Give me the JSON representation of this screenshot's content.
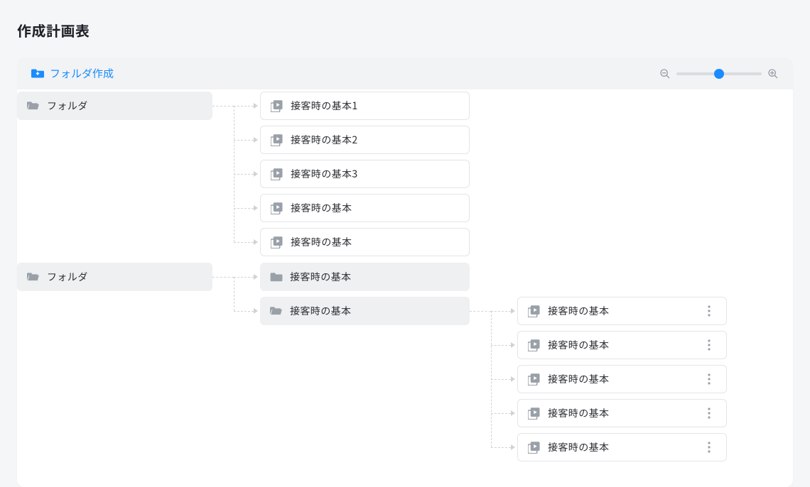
{
  "pageTitle": "作成計画表",
  "toolbar": {
    "createFolderLabel": "フォルダ作成",
    "zoomValue": 50
  },
  "root": [
    {
      "type": "folder",
      "label": "フォルダ",
      "children": [
        {
          "type": "item",
          "label": "接客時の基本1"
        },
        {
          "type": "item",
          "label": "接客時の基本2"
        },
        {
          "type": "item",
          "label": "接客時の基本3"
        },
        {
          "type": "item",
          "label": "接客時の基本"
        },
        {
          "type": "item",
          "label": "接客時の基本"
        }
      ]
    },
    {
      "type": "folder",
      "label": "フォルダ",
      "children": [
        {
          "type": "subfolder-closed",
          "label": "接客時の基本"
        },
        {
          "type": "subfolder-open",
          "label": "接客時の基本",
          "children": [
            {
              "type": "item",
              "label": "接客時の基本",
              "hasMenu": true
            },
            {
              "type": "item",
              "label": "接客時の基本",
              "hasMenu": true
            },
            {
              "type": "item",
              "label": "接客時の基本",
              "hasMenu": true
            },
            {
              "type": "item",
              "label": "接客時の基本",
              "hasMenu": true
            },
            {
              "type": "item",
              "label": "接客時の基本",
              "hasMenu": true
            }
          ]
        }
      ]
    }
  ]
}
